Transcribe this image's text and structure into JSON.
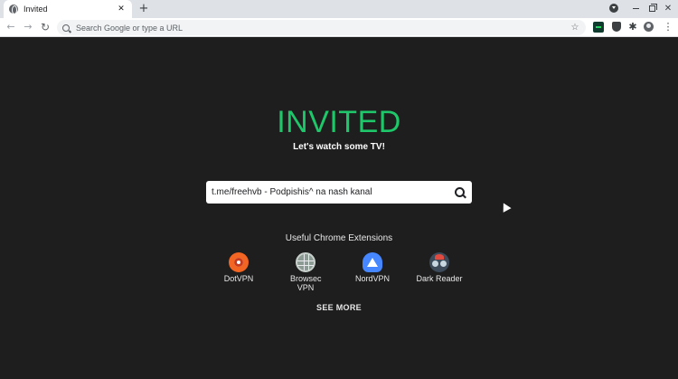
{
  "browser": {
    "tab": {
      "title": "Invited",
      "close_glyph": "✕"
    },
    "new_tab_glyph": "+",
    "omnibox": {
      "placeholder": "Search Google or type a URL"
    },
    "nav": {
      "back_glyph": "←",
      "forward_glyph": "→",
      "reload_glyph": "↻"
    },
    "bookmark_glyph": "☆",
    "window": {
      "close_glyph": "✕"
    },
    "extensions_glyph": "✱",
    "menu_glyph": "⋮"
  },
  "page": {
    "brand": "INVITED",
    "brand_color": "#1ec76a",
    "tagline": "Let's watch some TV!",
    "search": {
      "value": "t.me/freehvb - Podpishis^ na nash kanal"
    },
    "extensions_heading": "Useful Chrome Extensions",
    "extensions": [
      {
        "label": "DotVPN",
        "icon": "dotvpn-icon"
      },
      {
        "label": "Browsec VPN",
        "icon": "browsec-globe-icon"
      },
      {
        "label": "NordVPN",
        "icon": "nordvpn-icon"
      },
      {
        "label": "Dark Reader",
        "icon": "dark-reader-icon"
      }
    ],
    "see_more": "SEE MORE"
  }
}
